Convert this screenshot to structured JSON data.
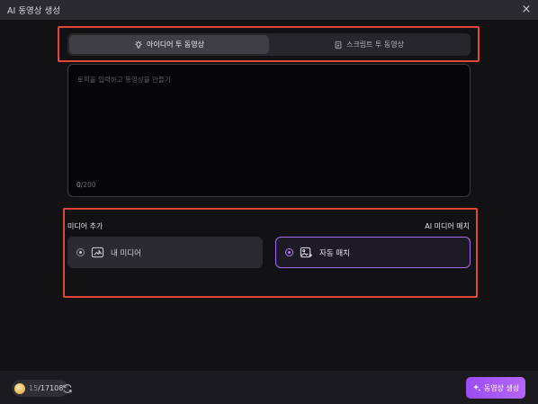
{
  "window": {
    "title": "AI 동영상 생성",
    "close_icon": "×"
  },
  "tabs": [
    {
      "label": "아이디어 투 동영상",
      "icon": "lightbulb-icon",
      "active": true
    },
    {
      "label": "스크립트 투 동영상",
      "icon": "script-icon",
      "active": false
    }
  ],
  "topic_input": {
    "placeholder": "토픽을 입력하고 동영상을 만들기",
    "count": "0",
    "max": "/200"
  },
  "media": {
    "title": "미디어 추가",
    "right_label": "AI 미디어 매치",
    "options": [
      {
        "label": "내 미디어",
        "icon": "folder-media-icon",
        "selected": false
      },
      {
        "label": "자동 매치",
        "icon": "image-sparkle-icon",
        "selected": true
      }
    ]
  },
  "footer": {
    "credits_used": "15",
    "credits_total": "/17108",
    "generate_label": "동영상 생성"
  },
  "colors": {
    "accent": "#a56cf0",
    "highlight": "#e0483b",
    "button": "#9a4df5"
  }
}
